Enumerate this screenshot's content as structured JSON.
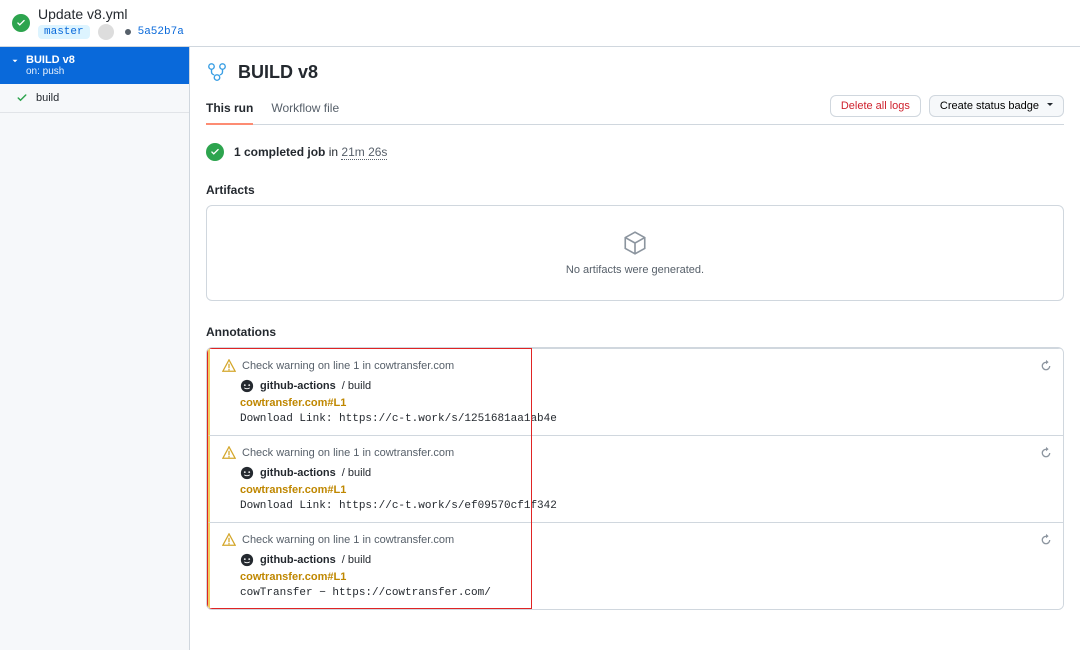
{
  "topbar": {
    "commit_title": "Update v8.yml",
    "branch": "master",
    "commit_sha": "5a52b7a"
  },
  "sidebar": {
    "active": {
      "title": "BUILD v8",
      "subtitle": "on: push"
    },
    "items": [
      {
        "label": "build"
      }
    ]
  },
  "header": {
    "title": "BUILD v8"
  },
  "tabs": {
    "this_run": "This run",
    "workflow_file": "Workflow file"
  },
  "actions": {
    "delete_logs": "Delete all logs",
    "status_badge": "Create status badge"
  },
  "summary": {
    "completed": "1 completed job",
    "in": "in",
    "duration": "21m 26s"
  },
  "artifacts": {
    "title": "Artifacts",
    "empty": "No artifacts were generated."
  },
  "annotations": {
    "title": "Annotations",
    "actor": "github-actions",
    "separator": " / ",
    "job_name": "build",
    "items": [
      {
        "head": "Check warning on line 1 in cowtransfer.com",
        "link_label": "cowtransfer.com#L1",
        "message": "Download Link: https://c-t.work/s/1251681aa1ab4e"
      },
      {
        "head": "Check warning on line 1 in cowtransfer.com",
        "link_label": "cowtransfer.com#L1",
        "message": "Download Link: https://c-t.work/s/ef09570cf1f342"
      },
      {
        "head": "Check warning on line 1 in cowtransfer.com",
        "link_label": "cowtransfer.com#L1",
        "message": "cowTransfer − https://cowtransfer.com/"
      }
    ]
  }
}
